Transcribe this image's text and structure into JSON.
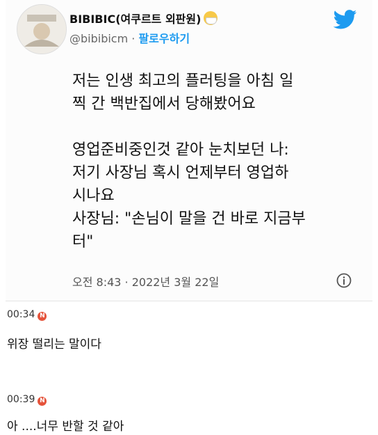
{
  "tweet": {
    "author_name": "BIBIBIC(여쿠르트 외판원)",
    "handle": "@bibibicm",
    "separator": " · ",
    "follow_label": "팔로우하기",
    "body_lines": [
      "저는 인생 최고의 플러팅을 아침 일",
      "찍 간 백반집에서 당해봤어요",
      "",
      "영업준비중인것 같아 눈치보던 나:",
      "저기 사장님 혹시 언제부터 영업하",
      "시나요",
      "사장님: \"손님이 말을 건 바로 지금부",
      "터\""
    ],
    "timestamp": "오전 8:43 · 2022년 3월 22일",
    "brand_color": "#1d9bf0"
  },
  "comments": [
    {
      "time": "00:34",
      "badge": "N",
      "text": "위장 떨리는 말이다"
    },
    {
      "time": "00:39",
      "badge": "N",
      "text": "아 ....너무 반할 것 같아"
    }
  ],
  "colors": {
    "badge": "#e5533b",
    "link": "#1d9bf0"
  }
}
